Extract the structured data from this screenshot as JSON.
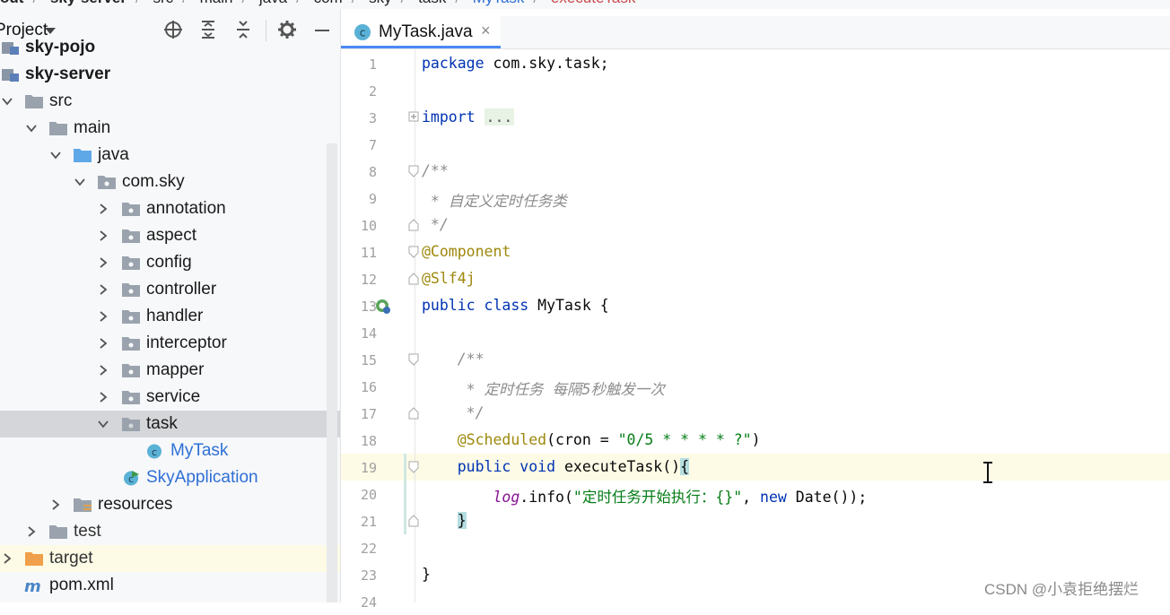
{
  "breadcrumb": [
    "out",
    "sky-server",
    "src",
    "main",
    "java",
    "com",
    "sky",
    "task",
    "MyTask",
    "executeTask"
  ],
  "project_panel": {
    "title": "Project",
    "tree": [
      {
        "label": "sky-pojo",
        "depth": 0,
        "type": "module",
        "bold": true
      },
      {
        "label": "sky-server",
        "depth": 0,
        "type": "module",
        "bold": true
      },
      {
        "label": "src",
        "depth": 1,
        "type": "folder",
        "expanded": true
      },
      {
        "label": "main",
        "depth": 2,
        "type": "folder",
        "expanded": true
      },
      {
        "label": "java",
        "depth": 3,
        "type": "source-folder",
        "expanded": true
      },
      {
        "label": "com.sky",
        "depth": 4,
        "type": "package",
        "expanded": true
      },
      {
        "label": "annotation",
        "depth": 5,
        "type": "package"
      },
      {
        "label": "aspect",
        "depth": 5,
        "type": "package"
      },
      {
        "label": "config",
        "depth": 5,
        "type": "package"
      },
      {
        "label": "controller",
        "depth": 5,
        "type": "package"
      },
      {
        "label": "handler",
        "depth": 5,
        "type": "package"
      },
      {
        "label": "interceptor",
        "depth": 5,
        "type": "package"
      },
      {
        "label": "mapper",
        "depth": 5,
        "type": "package"
      },
      {
        "label": "service",
        "depth": 5,
        "type": "package"
      },
      {
        "label": "task",
        "depth": 5,
        "type": "package",
        "expanded": true,
        "selected": true
      },
      {
        "label": "MyTask",
        "depth": 6,
        "type": "class"
      },
      {
        "label": "SkyApplication",
        "depth": 5,
        "type": "app-class"
      },
      {
        "label": "resources",
        "depth": 3,
        "type": "resources"
      },
      {
        "label": "test",
        "depth": 2,
        "type": "folder"
      },
      {
        "label": "target",
        "depth": 1,
        "type": "target-folder"
      },
      {
        "label": "pom.xml",
        "depth": 1,
        "type": "maven"
      }
    ]
  },
  "editor": {
    "tab_label": "MyTask.java",
    "lines": [
      {
        "n": "1",
        "text": "package com.sky.task;"
      },
      {
        "n": "2",
        "text": ""
      },
      {
        "n": "3",
        "text": "import ..."
      },
      {
        "n": "7",
        "text": ""
      },
      {
        "n": "8",
        "text": "/**"
      },
      {
        "n": "9",
        "text": " * 自定义定时任务类"
      },
      {
        "n": "10",
        "text": " */"
      },
      {
        "n": "11",
        "text": "@Component"
      },
      {
        "n": "12",
        "text": "@Slf4j"
      },
      {
        "n": "13",
        "text": "public class MyTask {"
      },
      {
        "n": "14",
        "text": ""
      },
      {
        "n": "15",
        "text": "    /**"
      },
      {
        "n": "16",
        "text": "     * 定时任务 每隔5秒触发一次"
      },
      {
        "n": "17",
        "text": "     */"
      },
      {
        "n": "18",
        "text": "    @Scheduled(cron = \"0/5 * * * * ?\")"
      },
      {
        "n": "19",
        "text": "    public void executeTask(){"
      },
      {
        "n": "20",
        "text": "        log.info(\"定时任务开始执行：{}\", new Date());"
      },
      {
        "n": "21",
        "text": "    }"
      },
      {
        "n": "22",
        "text": ""
      },
      {
        "n": "23",
        "text": "}"
      },
      {
        "n": "24",
        "text": ""
      }
    ]
  },
  "watermark": "CSDN @小袁拒绝摆烂",
  "colors": {
    "keyword": "#0033b3",
    "annotation": "#9e880d",
    "comment": "#8c8c8c",
    "string": "#067d17",
    "selection": "#d5d6d9",
    "current_line": "#fdfbe6",
    "tab_underline": "#4a8bf5"
  }
}
